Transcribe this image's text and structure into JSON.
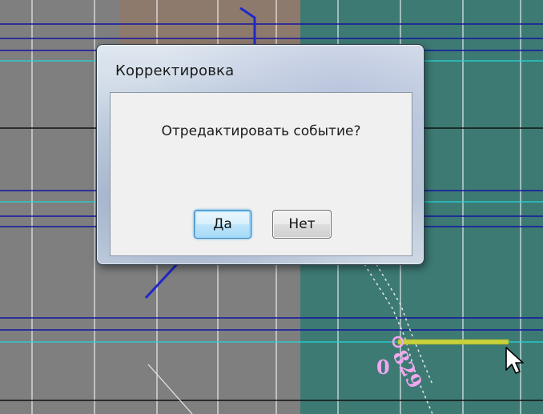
{
  "dialog": {
    "title": "Корректировка",
    "message": "Отредактировать событие?",
    "yes_label": "Да",
    "no_label": "Нет"
  },
  "map": {
    "labels": {
      "zero": "0",
      "number": "829"
    },
    "colors": {
      "gray_area": "#7f7f7f",
      "teal_area": "#3d7a74",
      "brown_area": "#8e7a6c",
      "blue_line": "#1414a0",
      "cyan_line": "#22d6d6",
      "black_line": "#111111",
      "white_line": "#ffffff",
      "yellow_segment": "#c8d23c",
      "pink_label": "#f2a6f0"
    }
  },
  "cursor": {
    "icon": "arrow-cursor-icon"
  }
}
